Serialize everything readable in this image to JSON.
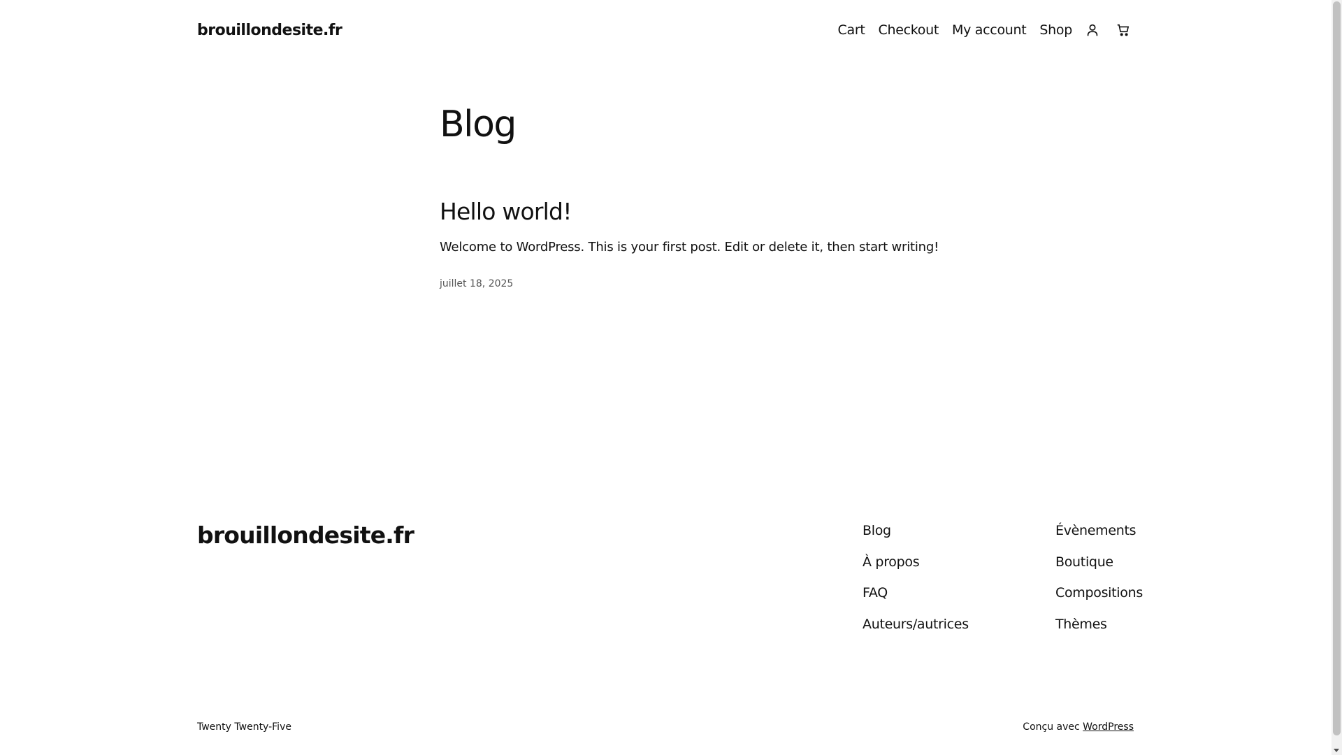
{
  "header": {
    "site_title": "brouillondesite.fr",
    "nav": [
      "Cart",
      "Checkout",
      "My account",
      "Shop"
    ],
    "icons": [
      "user-icon",
      "cart-icon"
    ]
  },
  "main": {
    "page_title": "Blog",
    "post": {
      "title": "Hello world!",
      "excerpt": "Welcome to WordPress. This is your first post. Edit or delete it, then start writing!",
      "date": "juillet 18, 2025"
    }
  },
  "footer": {
    "site_title": "brouillondesite.fr",
    "col1": [
      "Blog",
      "À propos",
      "FAQ",
      "Auteurs/autrices"
    ],
    "col2": [
      "Évènements",
      "Boutique",
      "Compositions",
      "Thèmes"
    ],
    "theme_name": "Twenty Twenty-Five",
    "credit_prefix": "Conçu avec",
    "credit_link": "WordPress"
  },
  "colors": {
    "text": "#111111",
    "background": "#ffffff",
    "muted": "#555555"
  }
}
